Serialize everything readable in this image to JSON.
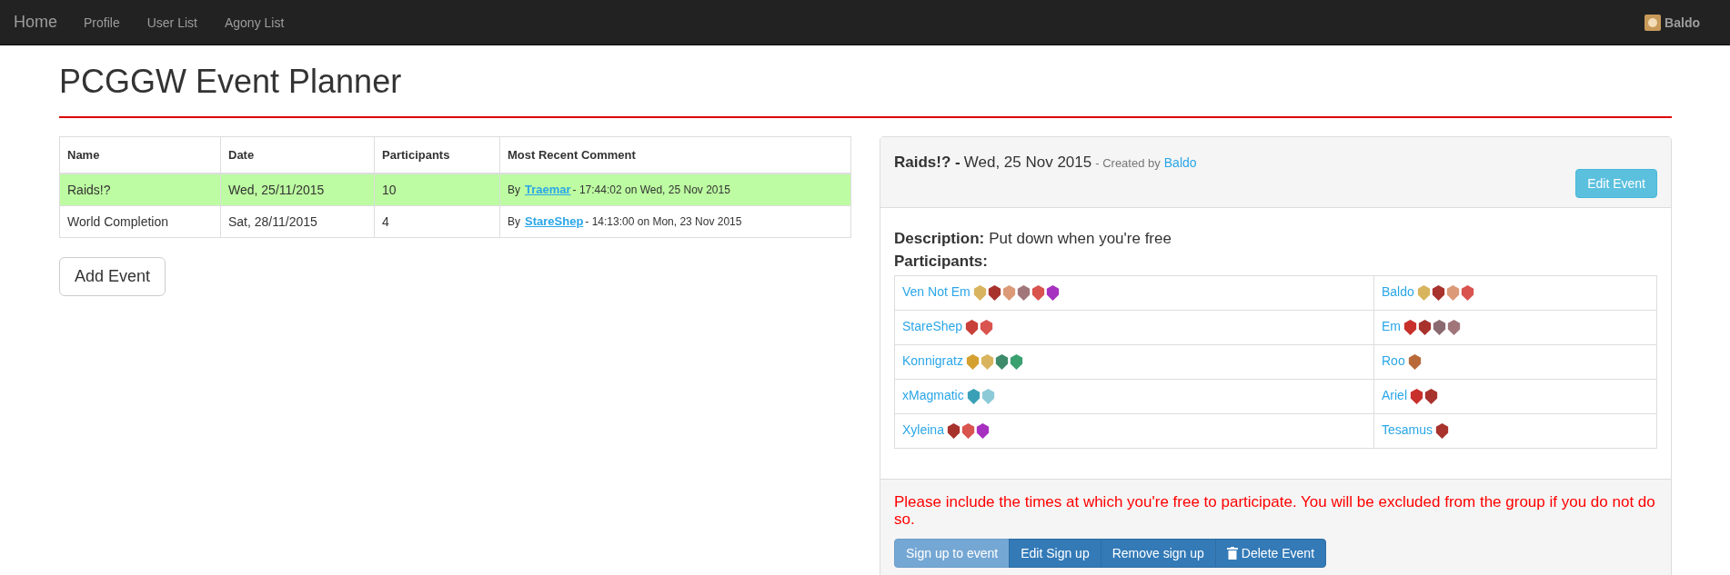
{
  "navbar": {
    "brand": "Home",
    "links": [
      "Profile",
      "User List",
      "Agony List"
    ],
    "user": "Baldo"
  },
  "page_title": "PCGGW Event Planner",
  "events_table": {
    "columns": [
      "Name",
      "Date",
      "Participants",
      "Most Recent Comment"
    ],
    "rows": [
      {
        "name": "Raids!?",
        "date": "Wed, 25/11/2015",
        "participants": "10",
        "comment_prefix": "By",
        "comment_author": "Traemar",
        "comment_time": "- 17:44:02 on Wed, 25 Nov 2015",
        "selected": true
      },
      {
        "name": "World Completion",
        "date": "Sat, 28/11/2015",
        "participants": "4",
        "comment_prefix": "By",
        "comment_author": "StareShep",
        "comment_time": "- 14:13:00 on Mon, 23 Nov 2015",
        "selected": false
      }
    ]
  },
  "add_event_button": "Add Event",
  "event_panel": {
    "name": "Raids!? -",
    "date": "Wed, 25 Nov 2015",
    "created_by": "- Created by",
    "creator": "Baldo",
    "edit_button": "Edit Event",
    "description_label": "Description:",
    "description": "Put down when you're free",
    "participants_label": "Participants:",
    "participants": [
      {
        "name": "Ven Not Em",
        "icons": [
          {
            "color": "#d9b45f"
          },
          {
            "color": "#a8322c"
          },
          {
            "color": "#dc9a78"
          },
          {
            "color": "#a0767a"
          },
          {
            "color": "#d9534f"
          },
          {
            "color": "#a630c0"
          }
        ]
      },
      {
        "name": "Baldo",
        "icons": [
          {
            "color": "#d9b45f"
          },
          {
            "color": "#a8322c"
          },
          {
            "color": "#dc9a78"
          },
          {
            "color": "#d9534f"
          }
        ]
      },
      {
        "name": "StareShep",
        "icons": [
          {
            "color": "#c8403a"
          },
          {
            "color": "#d9534f"
          }
        ]
      },
      {
        "name": "Em",
        "icons": [
          {
            "color": "#c8302c"
          },
          {
            "color": "#a8322c"
          },
          {
            "color": "#8a6a70"
          },
          {
            "color": "#a0767a"
          }
        ]
      },
      {
        "name": "Konnigratz",
        "icons": [
          {
            "color": "#d4a030"
          },
          {
            "color": "#d9b45f"
          },
          {
            "color": "#3d8a6a"
          },
          {
            "color": "#3aa070"
          }
        ]
      },
      {
        "name": "Roo",
        "icons": [
          {
            "color": "#b86a3a"
          }
        ]
      },
      {
        "name": "xMagmatic",
        "icons": [
          {
            "color": "#3aa0b8"
          },
          {
            "color": "#8ccad8"
          }
        ]
      },
      {
        "name": "Ariel",
        "icons": [
          {
            "color": "#c8302c"
          },
          {
            "color": "#a8322c"
          }
        ]
      },
      {
        "name": "Xyleina",
        "icons": [
          {
            "color": "#a8322c"
          },
          {
            "color": "#d9534f"
          },
          {
            "color": "#a630c0"
          }
        ]
      },
      {
        "name": "Tesamus",
        "icons": [
          {
            "color": "#a8322c"
          }
        ]
      }
    ],
    "warning": "Please include the times at which you're free to participate. You will be excluded from the group if you do not do so.",
    "actions": [
      {
        "label": "Sign up to event",
        "kind": "plain",
        "disabled": true
      },
      {
        "label": "Edit Sign up",
        "kind": "plain",
        "disabled": false
      },
      {
        "label": "Remove sign up",
        "kind": "plain",
        "disabled": false
      },
      {
        "label": "Delete Event",
        "kind": "delete",
        "disabled": false
      }
    ]
  }
}
